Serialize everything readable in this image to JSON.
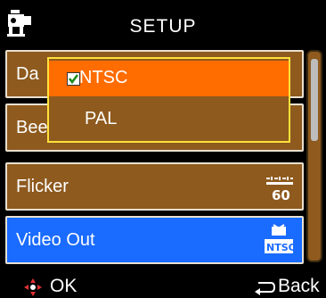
{
  "header": {
    "title": "SETUP",
    "icon": "camcorder-icon"
  },
  "menu": {
    "rows": [
      {
        "label": "Da",
        "icon": "date-icon"
      },
      {
        "label": "Beep",
        "icon": "speaker-icon"
      },
      {
        "label": "Flicker",
        "icon": "flicker-60-icon"
      },
      {
        "label": "Video Out",
        "icon": "tv-ntsc-icon"
      }
    ],
    "colors": {
      "row": "#8e5a1e",
      "selected": "#1a6bff",
      "border": "#e8e0d0"
    }
  },
  "popup": {
    "options": [
      {
        "label": "NTSC",
        "selected": true
      },
      {
        "label": "PAL",
        "selected": false
      }
    ],
    "colors": {
      "border": "#ffe23a",
      "highlight": "#ff6c00"
    }
  },
  "footer": {
    "ok_label": "OK",
    "back_label": "Back",
    "ok_icon": "dpad-icon",
    "back_icon": "return-arrow-icon"
  }
}
